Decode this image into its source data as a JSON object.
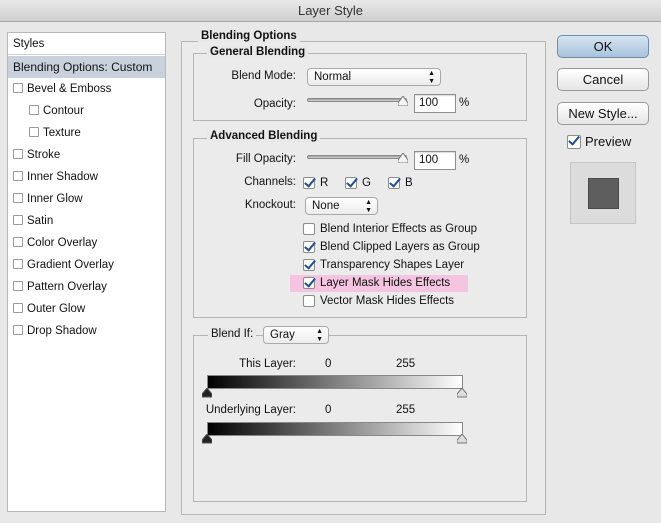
{
  "window": {
    "title": "Layer Style"
  },
  "styles_list": {
    "header": "Styles",
    "selected": "Blending Options: Custom",
    "items": [
      {
        "label": "Bevel & Emboss",
        "sub": false
      },
      {
        "label": "Contour",
        "sub": true
      },
      {
        "label": "Texture",
        "sub": true
      },
      {
        "label": "Stroke",
        "sub": false
      },
      {
        "label": "Inner Shadow",
        "sub": false
      },
      {
        "label": "Inner Glow",
        "sub": false
      },
      {
        "label": "Satin",
        "sub": false
      },
      {
        "label": "Color Overlay",
        "sub": false
      },
      {
        "label": "Gradient Overlay",
        "sub": false
      },
      {
        "label": "Pattern Overlay",
        "sub": false
      },
      {
        "label": "Outer Glow",
        "sub": false
      },
      {
        "label": "Drop Shadow",
        "sub": false
      }
    ]
  },
  "blending_options": {
    "title": "Blending Options",
    "general": {
      "title": "General Blending",
      "blend_mode_label": "Blend Mode:",
      "blend_mode_value": "Normal",
      "opacity_label": "Opacity:",
      "opacity_value": "100",
      "opacity_unit": "%",
      "opacity_level": 1.0
    },
    "advanced": {
      "title": "Advanced Blending",
      "fill_opacity_label": "Fill Opacity:",
      "fill_opacity_value": "100",
      "fill_opacity_unit": "%",
      "fill_opacity_level": 1.0,
      "channels_label": "Channels:",
      "channels": [
        {
          "label": "R",
          "checked": true
        },
        {
          "label": "G",
          "checked": true
        },
        {
          "label": "B",
          "checked": true
        }
      ],
      "knockout_label": "Knockout:",
      "knockout_value": "None",
      "options": [
        {
          "label": "Blend Interior Effects as Group",
          "checked": false,
          "highlighted": false
        },
        {
          "label": "Blend Clipped Layers as Group",
          "checked": true,
          "highlighted": false
        },
        {
          "label": "Transparency Shapes Layer",
          "checked": true,
          "highlighted": false
        },
        {
          "label": "Layer Mask Hides Effects",
          "checked": true,
          "highlighted": true
        },
        {
          "label": "Vector Mask Hides Effects",
          "checked": false,
          "highlighted": false
        }
      ],
      "highlight_color": "#f4c4e0"
    },
    "blend_if": {
      "label": "Blend If:",
      "value": "Gray",
      "this_layer_label": "This Layer:",
      "this_layer_low": "0",
      "this_layer_high": "255",
      "underlying_label": "Underlying Layer:",
      "underlying_low": "0",
      "underlying_high": "255"
    }
  },
  "buttons": {
    "ok": "OK",
    "cancel": "Cancel",
    "new_style": "New Style...",
    "preview_label": "Preview",
    "preview_checked": true
  },
  "colors": {
    "selected_row": "#c9d2dc",
    "default_button": "#a8c2dc",
    "checkmark": "#1d4f91",
    "preview_swatch": "#5e5e5e"
  }
}
